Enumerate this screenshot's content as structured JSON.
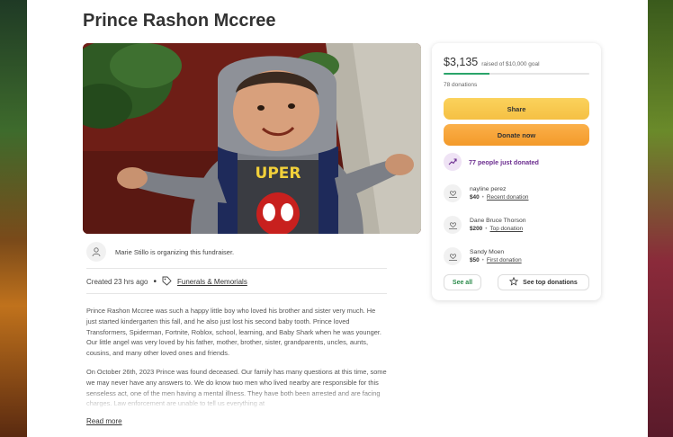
{
  "fundraiser": {
    "title": "Prince Rashon Mccree",
    "organizer_text": "Marie Stillo is organizing this fundraiser.",
    "created": "Created 23 hrs ago",
    "category": "Funerals & Memorials",
    "story": [
      "Prince Rashon Mccree was such a happy little boy who loved his brother and sister very much. He just started kindergarten this fall, and he also just lost his second baby tooth. Prince loved Transformers, Spiderman, Fortnite, Roblox, school, learning, and Baby Shark when he was younger. Our little angel was very loved by his father, mother, brother, sister, grandparents, uncles, aunts, cousins, and many other loved ones and friends.",
      "On October 26th, 2023 Prince was found deceased. Our family has many questions at this time, some we may never have any answers to. We do know two men who lived nearby are responsible for this senseless act, one of the men having a mental illness. They have both been arrested and are facing charges. Law enforcement are unable to tell us everything at"
    ],
    "read_more": "Read more"
  },
  "donation_card": {
    "amount_raised": "$3,135",
    "goal_text": "raised of $10,000 goal",
    "progress_fraction": 0.3135,
    "donations_count": "78 donations",
    "share_label": "Share",
    "donate_label": "Donate now",
    "recent_banner": "77 people just donated",
    "donors": [
      {
        "name": "nayline perez",
        "amount": "$40",
        "tag": "Recent donation"
      },
      {
        "name": "Dane Bruce Thorson",
        "amount": "$200",
        "tag": "Top donation"
      },
      {
        "name": "Sandy Moen",
        "amount": "$50",
        "tag": "First donation"
      }
    ],
    "see_all_label": "See all",
    "see_top_label": "See top donations"
  },
  "colors": {
    "progress": "#2aa46a",
    "share_button": "#f5c044",
    "donate_button": "#f39a2a",
    "banner_text": "#6b2d8f",
    "see_all_text": "#2a8a4a"
  },
  "icons": {
    "organizer_avatar": "person-icon",
    "category": "tag-icon",
    "trend": "trending-up-icon",
    "donor": "donor-heart-hand-icon",
    "see_top": "star-icon"
  }
}
